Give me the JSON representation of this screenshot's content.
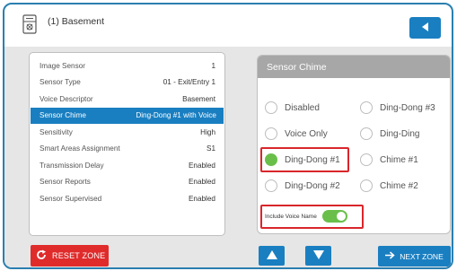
{
  "header": {
    "title": "(1) Basement",
    "icon": "sensor-device-icon",
    "back_icon": "back-arrow-icon"
  },
  "settings_list": [
    {
      "label": "Image Sensor",
      "value": "1"
    },
    {
      "label": "Sensor Type",
      "value": "01 - Exit/Entry 1"
    },
    {
      "label": "Voice Descriptor",
      "value": "Basement"
    },
    {
      "label": "Sensor Chime",
      "value": "Ding-Dong #1 with Voice"
    },
    {
      "label": "Sensitivity",
      "value": "High"
    },
    {
      "label": "Smart Areas Assignment",
      "value": "S1"
    },
    {
      "label": "Transmission Delay",
      "value": "Enabled"
    },
    {
      "label": "Sensor Reports",
      "value": "Enabled"
    },
    {
      "label": "Sensor Supervised",
      "value": "Enabled"
    }
  ],
  "selected_setting": "Sensor Chime",
  "chime_panel": {
    "title": "Sensor Chime",
    "options": [
      "Disabled",
      "Ding-Dong #3",
      "Voice Only",
      "Ding-Ding",
      "Ding-Dong #1",
      "Chime #1",
      "Ding-Dong #2",
      "Chime #2"
    ],
    "selected": "Ding-Dong #1",
    "include_voice_label": "Include Voice Name",
    "include_voice_on": true
  },
  "footer": {
    "reset_label": "RESET ZONE",
    "next_label": "NEXT ZONE",
    "up_icon": "up-arrow-icon",
    "down_icon": "down-arrow-icon"
  },
  "colors": {
    "accent": "#1a7fc1",
    "danger": "#e02b2b",
    "toggle_on": "#6abf4b",
    "panel_header": "#a7a7a7",
    "highlight": "#d9262b"
  }
}
